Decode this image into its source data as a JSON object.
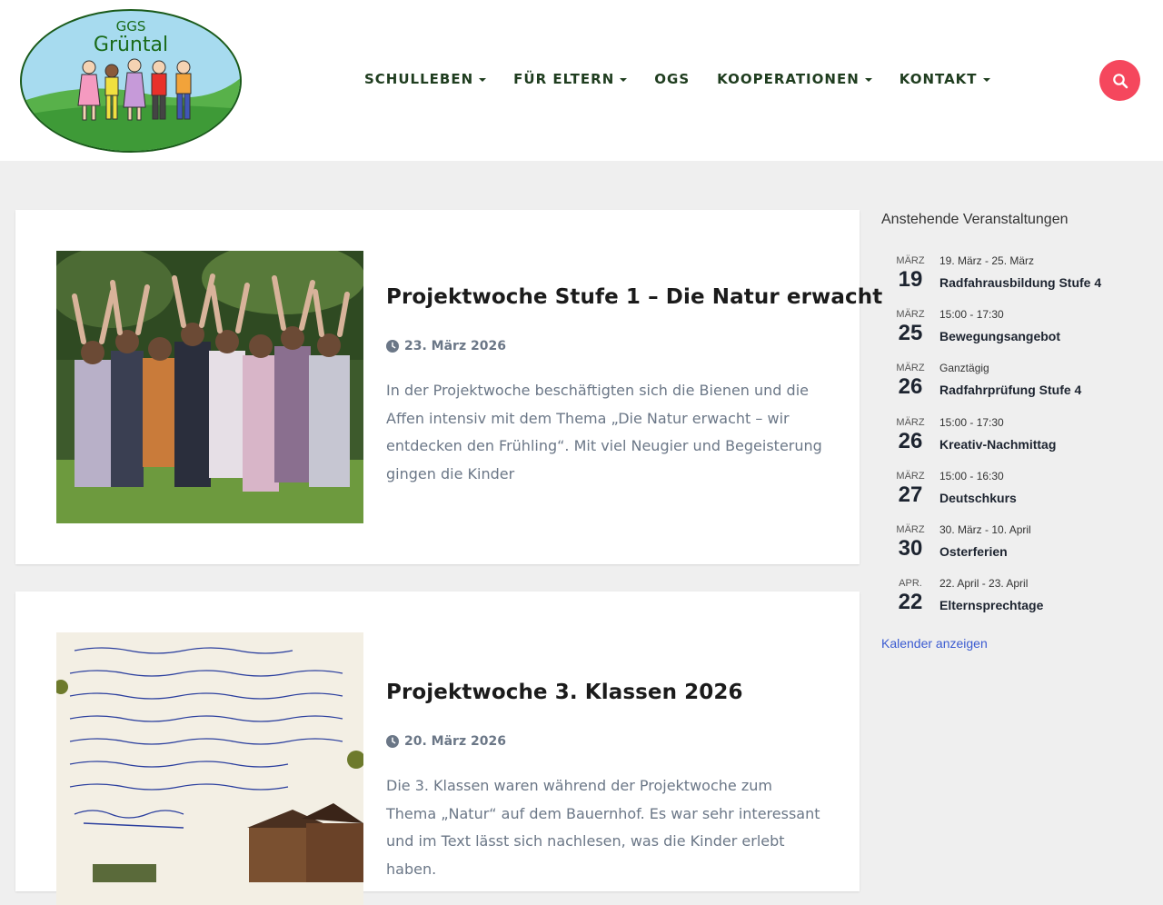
{
  "logo": {
    "line1": "GGS",
    "line2": "Grüntal"
  },
  "nav": {
    "items": [
      {
        "label": "SCHULLEBEN",
        "dropdown": true
      },
      {
        "label": "FÜR ELTERN",
        "dropdown": true
      },
      {
        "label": "OGS",
        "dropdown": false
      },
      {
        "label": "KOOPERATIONEN",
        "dropdown": true
      },
      {
        "label": "KONTAKT",
        "dropdown": true
      }
    ],
    "search_icon": "magnifier-icon"
  },
  "posts": [
    {
      "title": "Projektwoche Stufe 1 – Die Natur erwacht",
      "date": "23. März 2026",
      "excerpt": "In der Projektwoche beschäftigten sich die Bienen und die Affen intensiv mit dem Thema „Die Natur erwacht – wir entdecken den Frühling“. Mit viel Neugier und Begeisterung gingen die Kinder"
    },
    {
      "title": "Projektwoche 3. Klassen 2026",
      "date": "20. März 2026",
      "excerpt": "Die 3. Klassen waren während der Projektwoche zum Thema „Natur“ auf dem Bauernhof. Es war sehr interessant und im Text lässt sich nachlesen, was die Kinder erlebt haben."
    }
  ],
  "sidebar": {
    "title": "Anstehende Veranstaltungen",
    "events": [
      {
        "month": "März",
        "day": "19",
        "time": "19. März - 25. März",
        "name": "Radfahrausbildung Stufe 4"
      },
      {
        "month": "März",
        "day": "25",
        "time": "15:00 - 17:30",
        "name": "Bewegungsangebot"
      },
      {
        "month": "März",
        "day": "26",
        "time": "Ganztägig",
        "name": "Radfahrprüfung Stufe 4"
      },
      {
        "month": "März",
        "day": "26",
        "time": "15:00 - 17:30",
        "name": "Kreativ-Nachmittag"
      },
      {
        "month": "März",
        "day": "27",
        "time": "15:00 - 16:30",
        "name": "Deutschkurs"
      },
      {
        "month": "März",
        "day": "30",
        "time": "30. März - 10. April",
        "name": "Osterferien"
      },
      {
        "month": "Apr.",
        "day": "22",
        "time": "22. April - 23. April",
        "name": "Elternsprechtage"
      }
    ],
    "calendar_link": "Kalender anzeigen"
  },
  "colors": {
    "accent": "#f5475d",
    "nav_text": "#1f3d1f",
    "link": "#3b5bd1",
    "muted_text": "#6b7787"
  }
}
